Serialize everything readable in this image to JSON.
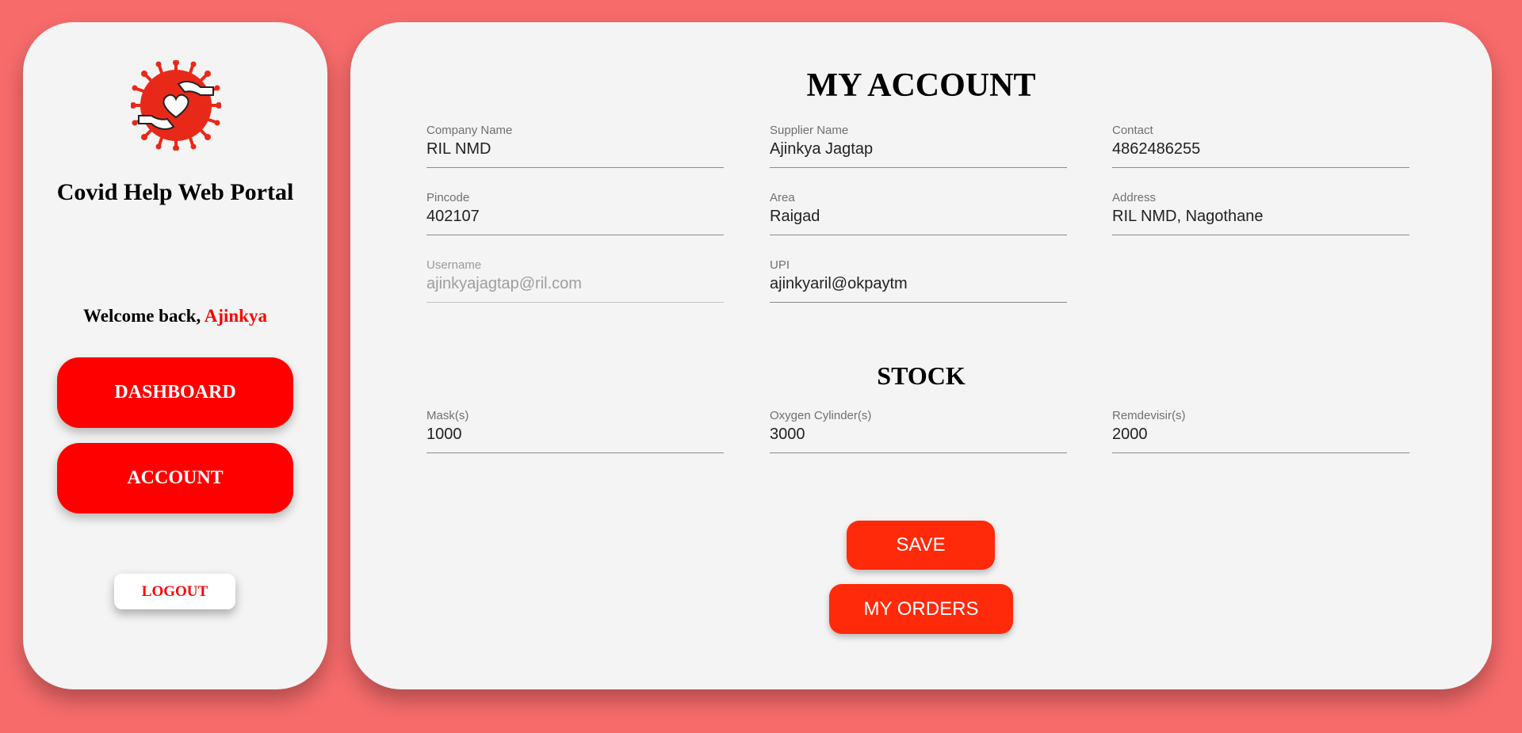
{
  "sidebar": {
    "logo_icon": "covid-help-hands-heart-icon",
    "portal_title": "Covid Help Web Portal",
    "welcome_prefix": "Welcome back, ",
    "welcome_name": "Ajinkya",
    "nav": {
      "dashboard_label": "DASHBOARD",
      "account_label": "ACCOUNT"
    },
    "logout_label": "LOGOUT"
  },
  "account": {
    "title": "MY ACCOUNT",
    "fields": {
      "company_name": {
        "label": "Company Name",
        "value": "RIL NMD"
      },
      "supplier_name": {
        "label": "Supplier Name",
        "value": "Ajinkya Jagtap"
      },
      "contact": {
        "label": "Contact",
        "value": "4862486255"
      },
      "pincode": {
        "label": "Pincode",
        "value": "402107"
      },
      "area": {
        "label": "Area",
        "value": "Raigad"
      },
      "address": {
        "label": "Address",
        "value": "RIL NMD, Nagothane"
      },
      "username": {
        "label": "Username",
        "value": "ajinkyajagtap@ril.com"
      },
      "upi": {
        "label": "UPI",
        "value": "ajinkyaril@okpaytm"
      }
    }
  },
  "stock": {
    "title": "STOCK",
    "fields": {
      "masks": {
        "label": "Mask(s)",
        "value": "1000"
      },
      "oxygen": {
        "label": "Oxygen Cylinder(s)",
        "value": "3000"
      },
      "remdesivir": {
        "label": "Remdevisir(s)",
        "value": "2000"
      }
    }
  },
  "actions": {
    "save_label": "SAVE",
    "orders_label": "MY ORDERS"
  },
  "colors": {
    "background": "#f76b6b",
    "panel": "#f4f4f4",
    "primary_red": "#ff0000",
    "button_red": "#ff2a0a"
  }
}
